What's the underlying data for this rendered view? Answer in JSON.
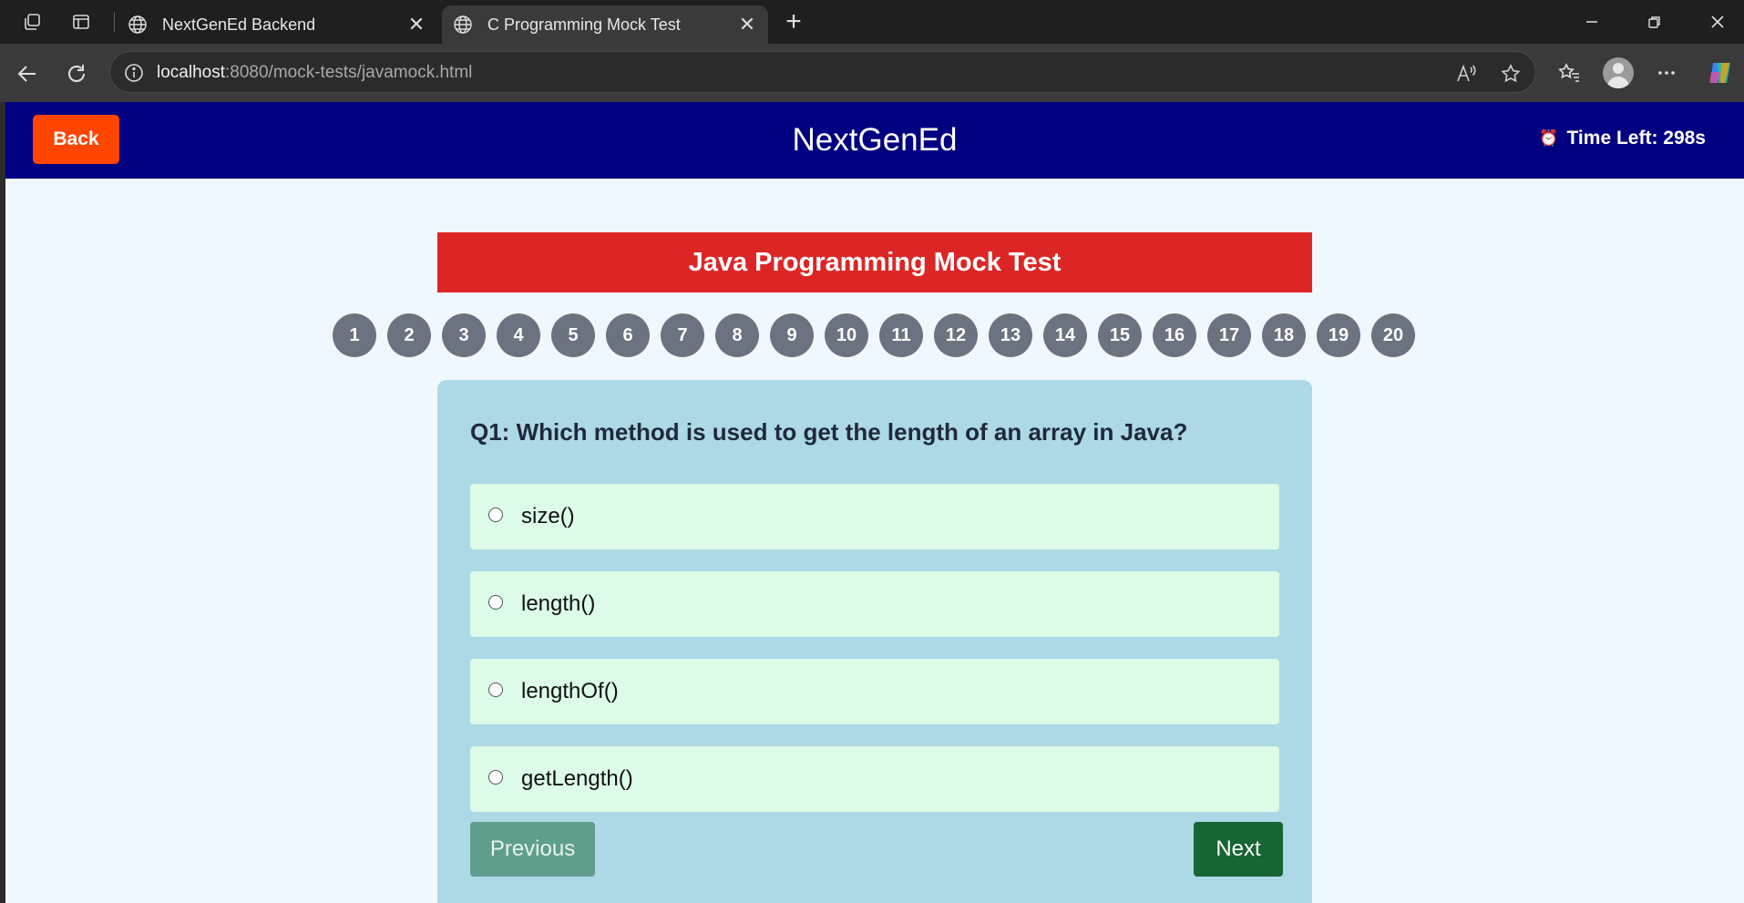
{
  "browser": {
    "tabs": [
      {
        "title": "NextGenEd Backend",
        "active": false
      },
      {
        "title": "C Programming Mock Test",
        "active": true
      }
    ],
    "address": {
      "host": "localhost",
      "path": ":8080/mock-tests/javamock.html"
    }
  },
  "header": {
    "back_label": "Back",
    "brand": "NextGenEd",
    "timer_icon": "⏰",
    "timer_label": "Time Left: 298s"
  },
  "test": {
    "title": "Java Programming Mock Test",
    "question_numbers": [
      "1",
      "2",
      "3",
      "4",
      "5",
      "6",
      "7",
      "8",
      "9",
      "10",
      "11",
      "12",
      "13",
      "14",
      "15",
      "16",
      "17",
      "18",
      "19",
      "20"
    ],
    "question": "Q1: Which method is used to get the length of an array in Java?",
    "options": [
      "size()",
      "length()",
      "lengthOf()",
      "getLength()"
    ],
    "prev_label": "Previous",
    "next_label": "Next"
  },
  "colors": {
    "header_bg": "#000080",
    "back_button": "#ff4500",
    "title_bar": "#dc2626",
    "question_number": "#6b7280",
    "card_bg": "#add8e6",
    "option_bg": "#dcfce7",
    "next_button": "#166534"
  }
}
